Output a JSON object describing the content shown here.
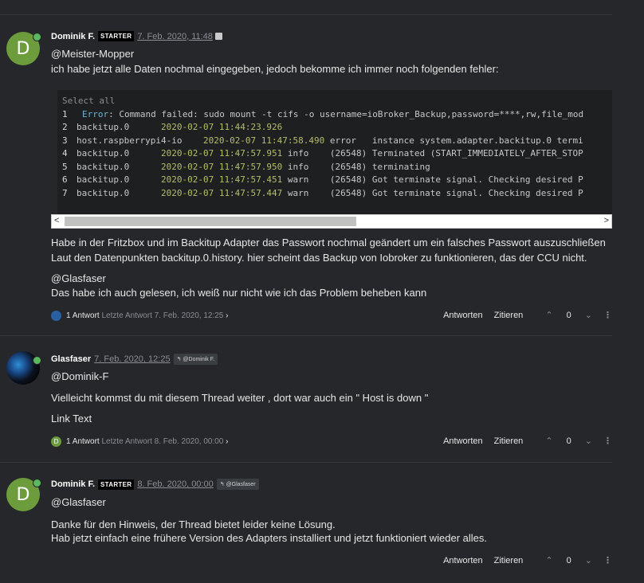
{
  "posts": [
    {
      "author": "Dominik F.",
      "badge": "STARTER",
      "time": "7. Feb. 2020, 11:48",
      "avatar_letter": "D",
      "mention": "@Meister-Mopper",
      "line1": "ich habe jetzt alle Daten nochmal eingegeben, jedoch bekomme ich immer noch folgenden fehler:",
      "code": {
        "select_all": "Select all",
        "lines": [
          {
            "n": "1",
            "a": "",
            "b": "Error",
            "c": ": Command failed: sudo mount -t cifs -o username=ioBroker_Backup,password=****,rw,file_mod"
          },
          {
            "n": "2",
            "a": "backitup.0      ",
            "b": "2020-02-07 11:44:23.926",
            "c": ""
          },
          {
            "n": "3",
            "a": "host.raspberrypi4-io    ",
            "b": "2020-02-07 11:47:58.490",
            "c": " error   instance system.adapter.backitup.0 termi"
          },
          {
            "n": "4",
            "a": "backitup.0      ",
            "b": "2020-02-07 11:47:57.951",
            "c": " info    (26548) Terminated (START_IMMEDIATELY_AFTER_STOP"
          },
          {
            "n": "5",
            "a": "backitup.0      ",
            "b": "2020-02-07 11:47:57.950",
            "c": " info    (26548) terminating"
          },
          {
            "n": "6",
            "a": "backitup.0      ",
            "b": "2020-02-07 11:47:57.451",
            "c": " warn    (26548) Got terminate signal. Checking desired P"
          },
          {
            "n": "7",
            "a": "backitup.0      ",
            "b": "2020-02-07 11:47:57.447",
            "c": " warn    (26548) Got terminate signal. Checking desired P"
          }
        ]
      },
      "para1a": "Habe in der Fritzbox und im Backitup Adapter das Passwort nochmal geändert um ein falsches Passwort auszuschließen",
      "para1b": "Laut den Datenpunkten backitup.0.history. hier scheint das Backup von Iobroker zu funktionieren, das der CCU nicht.",
      "mention2": "@Glasfaser",
      "para2": "Das habe ich auch gelesen, ich weiß nur nicht wie ich das Problem beheben kann",
      "replies": "1 Antwort",
      "last_reply": "Letzte Antwort 7. Feb. 2020, 12:25"
    },
    {
      "author": "Glasfaser",
      "time": "7. Feb. 2020, 12:25",
      "reply_to": "@Dominik F.",
      "mention": "@Dominik-F",
      "para1": "Vielleicht kommst du mit diesem Thread weiter , dort war auch ein \" Host is down \"",
      "link": "Link Text",
      "replies": "1 Antwort",
      "last_reply": "Letzte Antwort 8. Feb. 2020, 00:00"
    },
    {
      "author": "Dominik F.",
      "badge": "STARTER",
      "time": "8. Feb. 2020, 00:00",
      "avatar_letter": "D",
      "reply_to": "@Glasfaser",
      "mention": "@Glasfaser",
      "para1": "Danke für den Hinweis, der Thread bietet leider keine Lösung.",
      "para2": "Hab jetzt einfach eine frühere Version des Adapters installiert und jetzt funktioniert wieder alles."
    }
  ],
  "actions": {
    "reply": "Antworten",
    "quote": "Zitieren",
    "votes": "0"
  }
}
